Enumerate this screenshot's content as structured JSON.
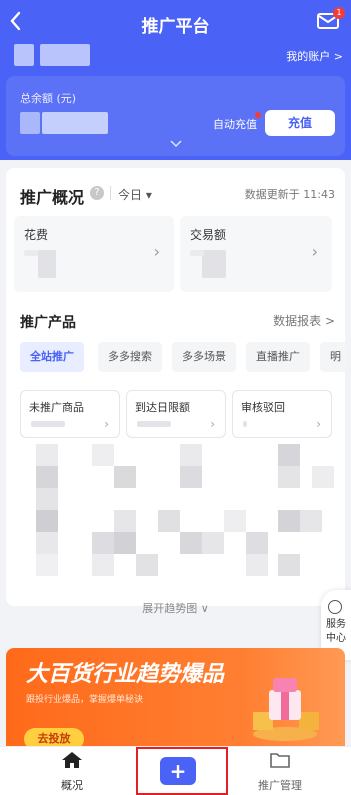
{
  "header": {
    "title": "推广平台",
    "back_icon": "chevron-left-icon",
    "mail_icon": "mail-icon",
    "mail_badge": "1",
    "account_link": "我的账户 >"
  },
  "balance": {
    "label": "总余额 (元)",
    "auto_recharge": "自动充值",
    "recharge_button": "充值"
  },
  "overview": {
    "title": "推广概况",
    "period": "今日 ▾",
    "updated": "数据更新于 11:43",
    "metrics": [
      {
        "label": "花费"
      },
      {
        "label": "交易额"
      }
    ]
  },
  "products": {
    "title": "推广产品",
    "report_link": "数据报表 >",
    "tabs": [
      "全站推广",
      "多多搜索",
      "多多场景",
      "直播推广",
      "明"
    ],
    "cards": [
      {
        "label": "未推广商品"
      },
      {
        "label": "到达日限额"
      },
      {
        "label": "审核驳回"
      }
    ],
    "expand": "展开趋势图 ∨"
  },
  "float": {
    "label": "服务中心",
    "icon": "smile-icon"
  },
  "banner": {
    "title": "大百货行业趋势爆品",
    "subtitle": "跟投行业爆品，掌握爆单秘诀",
    "button": "去投放"
  },
  "bottom_nav": {
    "home": "概况",
    "manage": "推广管理",
    "plus": "+"
  },
  "colors": {
    "primary": "#4a62f5",
    "banner": "#ff6a1a",
    "highlight": "#e32025"
  }
}
